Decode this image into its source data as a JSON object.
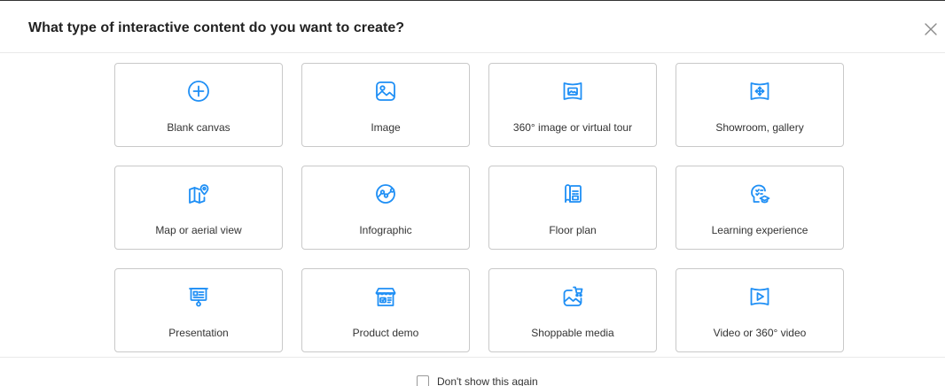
{
  "dialog": {
    "title": "What type of interactive content do you want to create?",
    "close_icon": "close-icon"
  },
  "accent_color": "#1f8ff5",
  "options": [
    {
      "label": "Blank canvas",
      "icon": "plus-circle-icon"
    },
    {
      "label": "Image",
      "icon": "image-icon"
    },
    {
      "label": "360° image or virtual tour",
      "icon": "panorama-image-icon"
    },
    {
      "label": "Showroom, gallery",
      "icon": "showroom-move-icon"
    },
    {
      "label": "Map or aerial view",
      "icon": "map-pin-icon"
    },
    {
      "label": "Infographic",
      "icon": "infographic-chart-icon"
    },
    {
      "label": "Floor plan",
      "icon": "floor-plan-icon"
    },
    {
      "label": "Learning experience",
      "icon": "learning-icon"
    },
    {
      "label": "Presentation",
      "icon": "presentation-board-icon"
    },
    {
      "label": "Product demo",
      "icon": "storefront-icon"
    },
    {
      "label": "Shoppable media",
      "icon": "shopping-cart-image-icon"
    },
    {
      "label": "Video or 360° video",
      "icon": "video-play-icon"
    }
  ],
  "footer": {
    "dont_show_label": "Don't show this again",
    "dont_show_checked": false
  }
}
